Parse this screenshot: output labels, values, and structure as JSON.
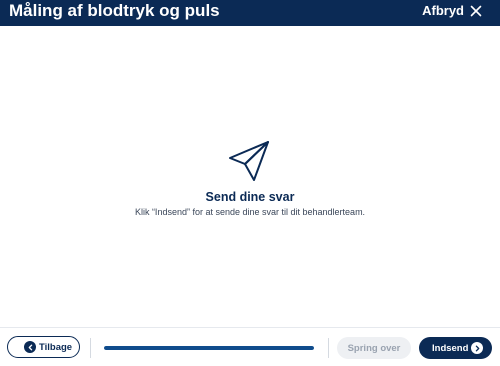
{
  "header": {
    "title": "Måling af blodtryk og puls",
    "cancel_label": "Afbryd",
    "cancel_icon": "close-icon",
    "background": "#0b2a55"
  },
  "main": {
    "icon": "paper-plane-icon",
    "title": "Send dine svar",
    "description": "Klik “Indsend” for at sende dine svar til dit behandlerteam."
  },
  "footer": {
    "back_label": "Tilbage",
    "back_icon": "chevron-left-icon",
    "progress_fraction": 1.0,
    "skip_label": "Spring over",
    "submit_label": "Indsend",
    "submit_icon": "chevron-right-icon"
  },
  "colors": {
    "primary": "#0b2a55",
    "progress": "#0f4c8c",
    "disabled_bg": "#eef0f3",
    "disabled_text": "#9aa3b0"
  }
}
